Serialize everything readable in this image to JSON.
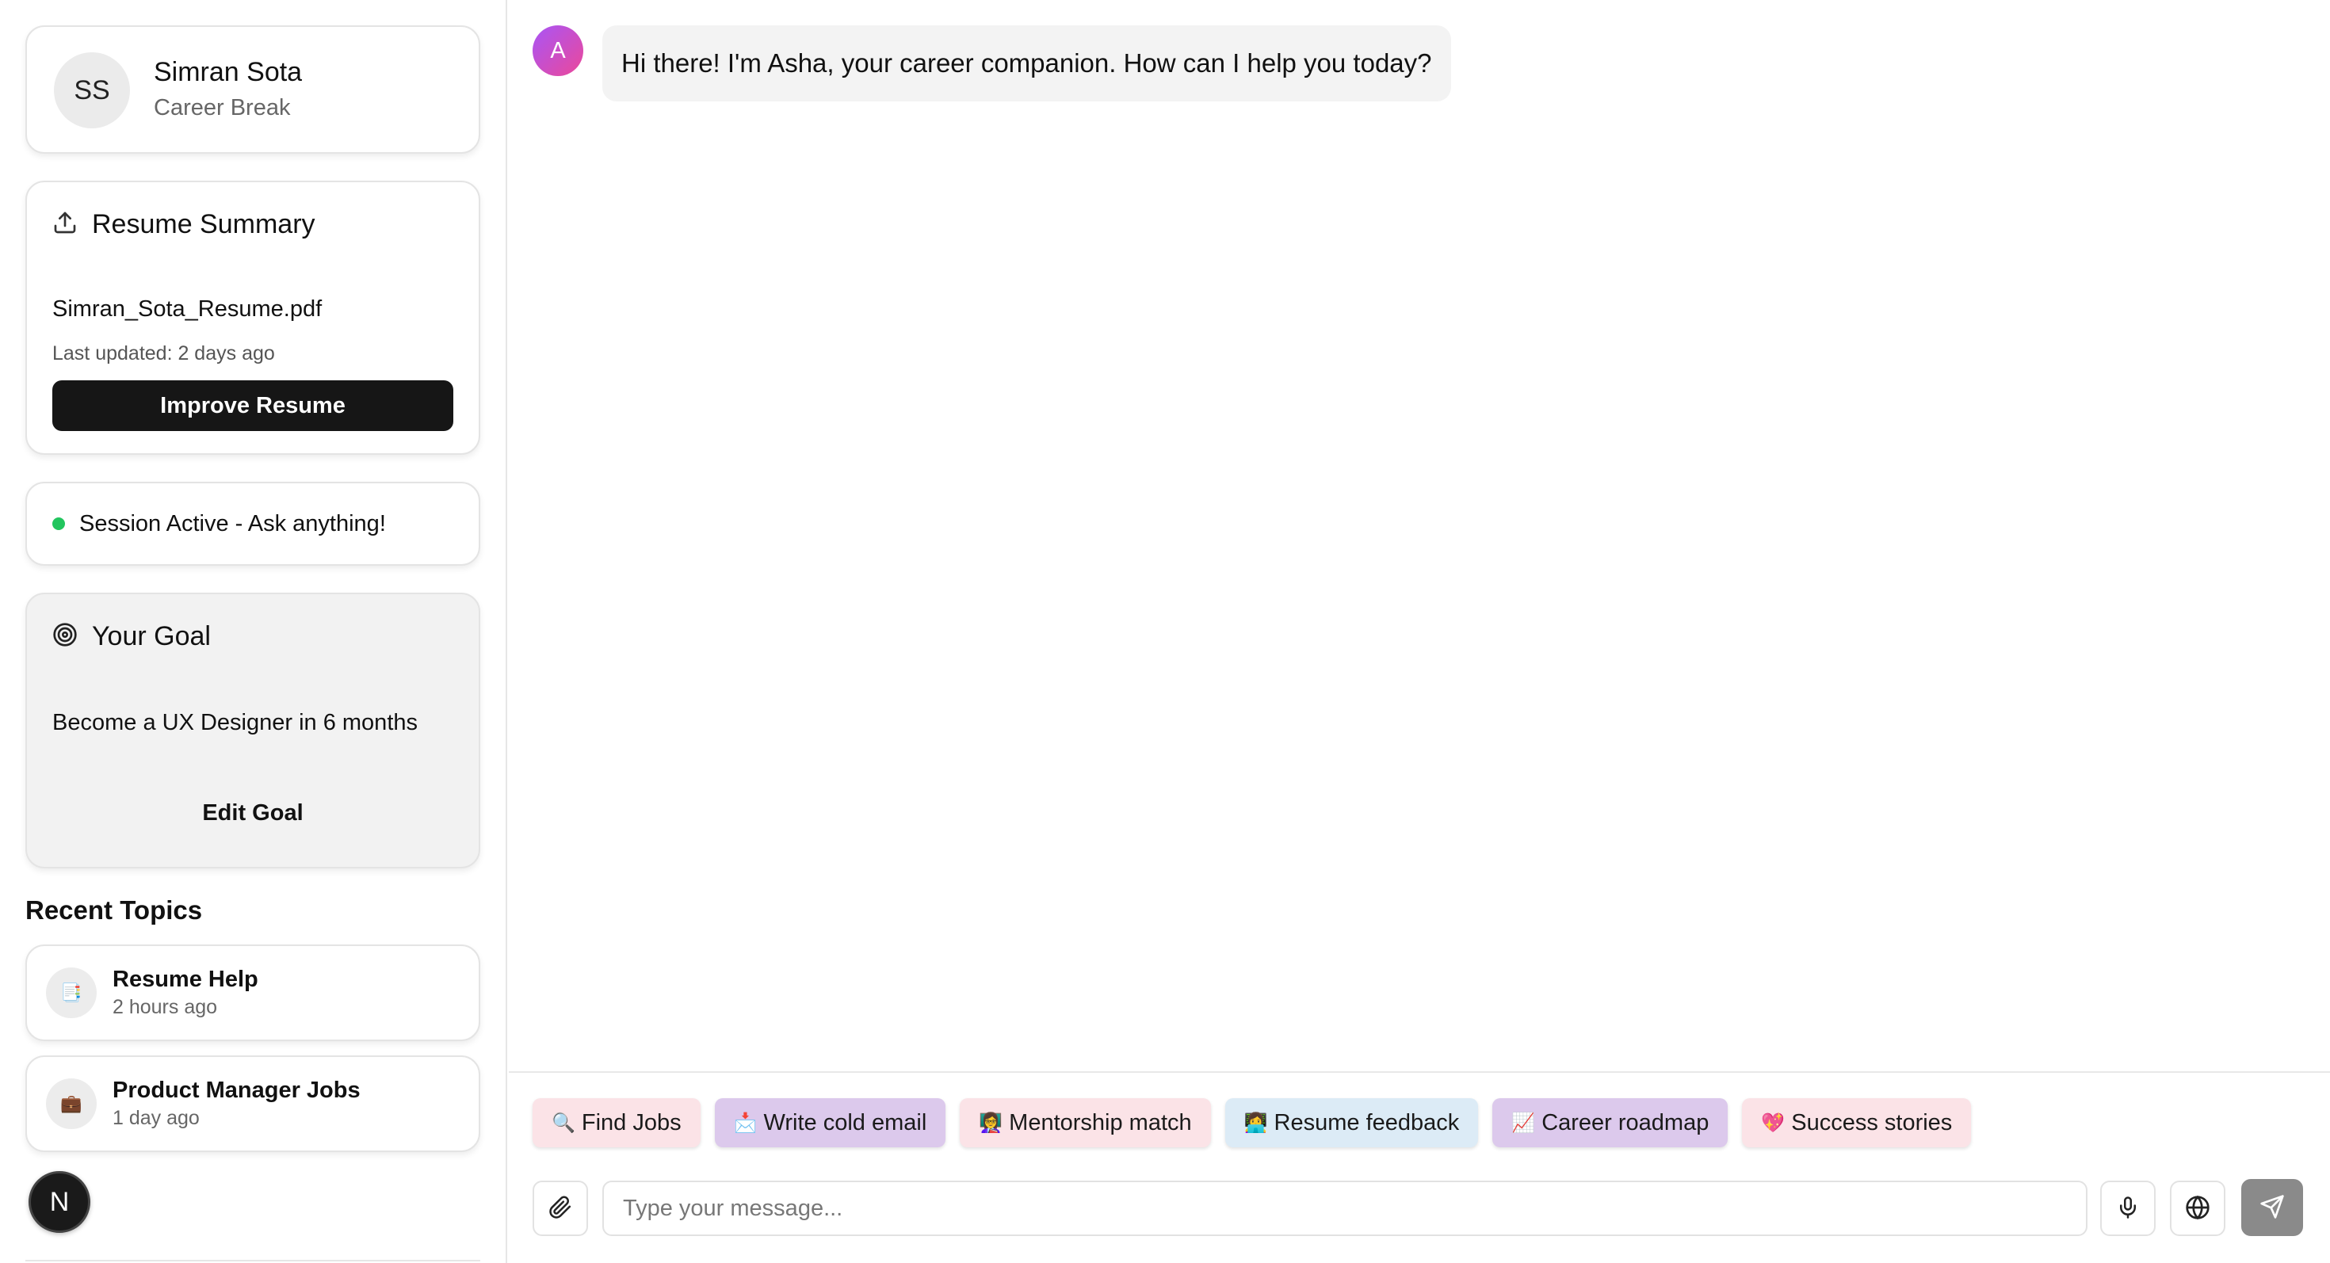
{
  "profile": {
    "initials": "SS",
    "name": "Simran Sota",
    "status": "Career Break"
  },
  "resume": {
    "title": "Resume Summary",
    "icon": "upload-icon",
    "file_name": "Simran_Sota_Resume.pdf",
    "last_updated": "Last updated: 2 days ago",
    "improve_label": "Improve Resume"
  },
  "session": {
    "text": "Session Active - Ask anything!",
    "status_color": "#22c55e"
  },
  "goal": {
    "title": "Your Goal",
    "icon": "target-icon",
    "text": "Become a UX Designer in 6 months",
    "edit_label": "Edit Goal"
  },
  "recent": {
    "title": "Recent Topics",
    "items": [
      {
        "title": "Resume Help",
        "time": "2 hours ago",
        "icon": "📑"
      },
      {
        "title": "Product Manager Jobs",
        "time": "1 day ago",
        "icon": "💼"
      }
    ]
  },
  "badge": {
    "letter": "N"
  },
  "chat": {
    "assistant_initial": "A",
    "message": "Hi there! I'm Asha, your career companion. How can I help you today?"
  },
  "quick_actions": [
    {
      "emoji": "🔍",
      "label": "Find Jobs",
      "color": "#fbe3e7"
    },
    {
      "emoji": "📩",
      "label": "Write cold email",
      "color": "#dcc9ec"
    },
    {
      "emoji": "👩‍🏫",
      "label": "Mentorship match",
      "color": "#fbe3e7"
    },
    {
      "emoji": "👩‍💻",
      "label": "Resume feedback",
      "color": "#dcebf6"
    },
    {
      "emoji": "📈",
      "label": "Career roadmap",
      "color": "#dcc9ec"
    },
    {
      "emoji": "💖",
      "label": "Success stories",
      "color": "#fbe3e7"
    }
  ],
  "composer": {
    "placeholder": "Type your message..."
  }
}
